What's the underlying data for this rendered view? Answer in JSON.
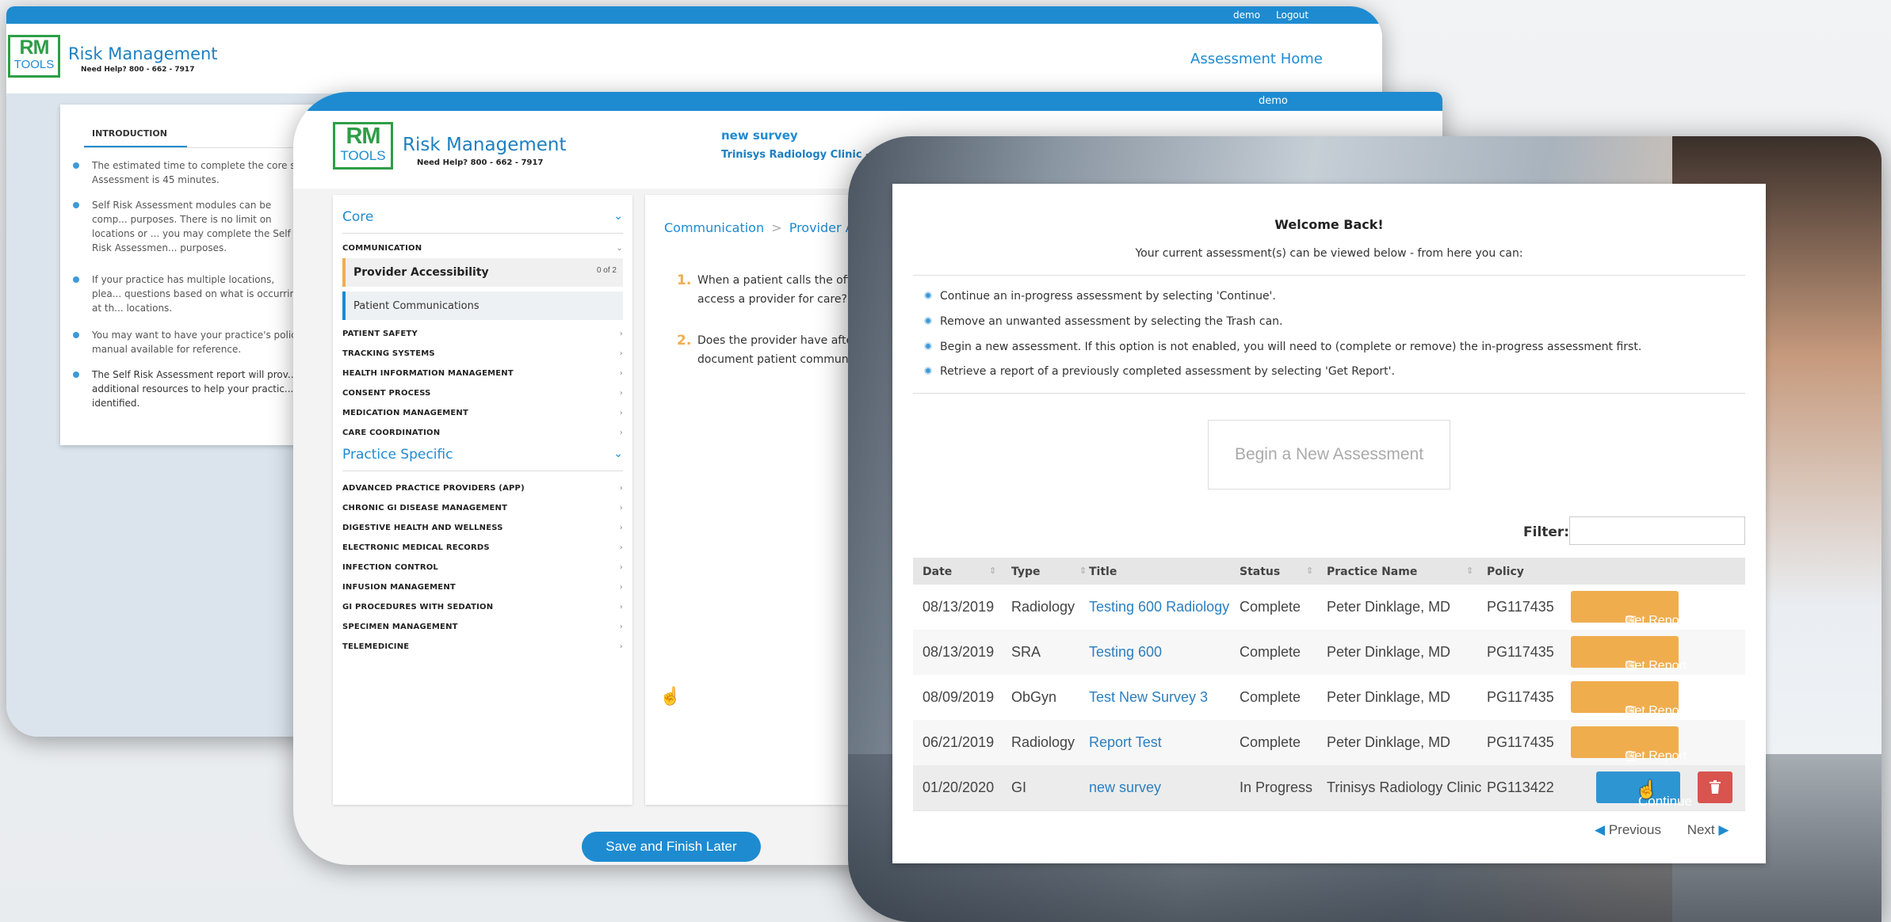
{
  "brand": {
    "logo_top": "RM",
    "logo_bottom": "TOOLS",
    "name": "Risk Management",
    "help": "Need Help? 800 - 662 - 7917"
  },
  "window1": {
    "topbar_user": "demo",
    "topbar_logout": "Logout",
    "nav_link": "Assessment Home",
    "intro_title": "INTRODUCTION",
    "bullets": [
      "The estimated time to complete the core s... Assessment is 45 minutes.",
      "Self Risk Assessment modules can be comp... purposes. There is no limit on locations or ... you may complete the Self Risk Assessmen... purposes.",
      "If your practice has multiple locations, plea... questions based on what is occurring at th... locations.",
      "You may want to have your practice's polic... manual available for reference.",
      "The Self Risk Assessment report will prov... additional resources to help your practic... identified."
    ]
  },
  "window2": {
    "topbar_user": "demo",
    "survey_title": "new survey",
    "survey_clinic": "Trinisys Radiology Clinic - ...",
    "core_label": "Core",
    "communication_label": "COMMUNICATION",
    "provider_accessibility": "Provider Accessibility",
    "provider_count": "0 of 2",
    "patient_communications": "Patient Communications",
    "core_sections": [
      "PATIENT SAFETY",
      "TRACKING SYSTEMS",
      "HEALTH INFORMATION MANAGEMENT",
      "CONSENT PROCESS",
      "MEDICATION MANAGEMENT",
      "CARE COORDINATION"
    ],
    "practice_label": "Practice Specific",
    "practice_sections": [
      "ADVANCED PRACTICE PROVIDERS (APP)",
      "CHRONIC GI DISEASE MANAGEMENT",
      "DIGESTIVE HEALTH AND WELLNESS",
      "ELECTRONIC MEDICAL RECORDS",
      "INFECTION CONTROL",
      "INFUSION MANAGEMENT",
      "GI PROCEDURES WITH SEDATION",
      "SPECIMEN MANAGEMENT",
      "TELEMEDICINE"
    ],
    "breadcrumb_part1": "Communication",
    "breadcrumb_sep": ">",
    "breadcrumb_part2": "Provider Acce...",
    "questions": [
      {
        "num": "1.",
        "line1": "When a patient calls the offi...",
        "line2": "access a provider for care?"
      },
      {
        "num": "2.",
        "line1": "Does the provider have afte...",
        "line2": "document patient communic..."
      }
    ],
    "save_button": "Save and Finish Later"
  },
  "window3": {
    "welcome_title": "Welcome Back!",
    "welcome_sub": "Your current assessment(s) can be viewed below - from here you can:",
    "instructions": [
      "Continue an in-progress assessment by selecting 'Continue'.",
      "Remove an unwanted assessment by selecting the Trash can.",
      "Begin a new assessment. If this option is not enabled, you will need to (complete or remove) the in-progress assessment first.",
      "Retrieve a report of a previously completed assessment by selecting 'Get Report'."
    ],
    "begin_button": "Begin a New Assessment",
    "filter_label": "Filter:",
    "filter_value": "",
    "columns": [
      "Date",
      "Type",
      "Title",
      "Status",
      "Practice Name",
      "Policy"
    ],
    "rows": [
      {
        "date": "08/13/2019",
        "type": "Radiology",
        "title": "Testing 600 Radiology",
        "status": "Complete",
        "practice": "Peter Dinklage, MD",
        "policy": "PG117435",
        "action": "Get Report"
      },
      {
        "date": "08/13/2019",
        "type": "SRA",
        "title": "Testing 600",
        "status": "Complete",
        "practice": "Peter Dinklage, MD",
        "policy": "PG117435",
        "action": "Get Report"
      },
      {
        "date": "08/09/2019",
        "type": "ObGyn",
        "title": "Test New Survey 3",
        "status": "Complete",
        "practice": "Peter Dinklage, MD",
        "policy": "PG117435",
        "action": "Get Report"
      },
      {
        "date": "06/21/2019",
        "type": "Radiology",
        "title": "Report Test",
        "status": "Complete",
        "practice": "Peter Dinklage, MD",
        "policy": "PG117435",
        "action": "Get Report"
      }
    ],
    "inprogress_row": {
      "date": "01/20/2020",
      "type": "GI",
      "title": "new survey",
      "status": "In Progress",
      "practice": "Trinisys Radiology Clinic",
      "policy": "PG113422",
      "action": "Continue"
    },
    "previous_label": "Previous",
    "next_label": "Next"
  },
  "icons": [
    "chart-icon",
    "trash-icon",
    "chevron-down-icon",
    "chevron-right-icon",
    "hand-cursor-icon",
    "caret-left-icon",
    "caret-right-icon"
  ],
  "colors": {
    "accent_blue": "#1e8bd1",
    "report_orange": "#f0ad4e",
    "continue_blue": "#2e95d3",
    "trash_red": "#d9534f",
    "logo_green": "#2e9e47"
  }
}
